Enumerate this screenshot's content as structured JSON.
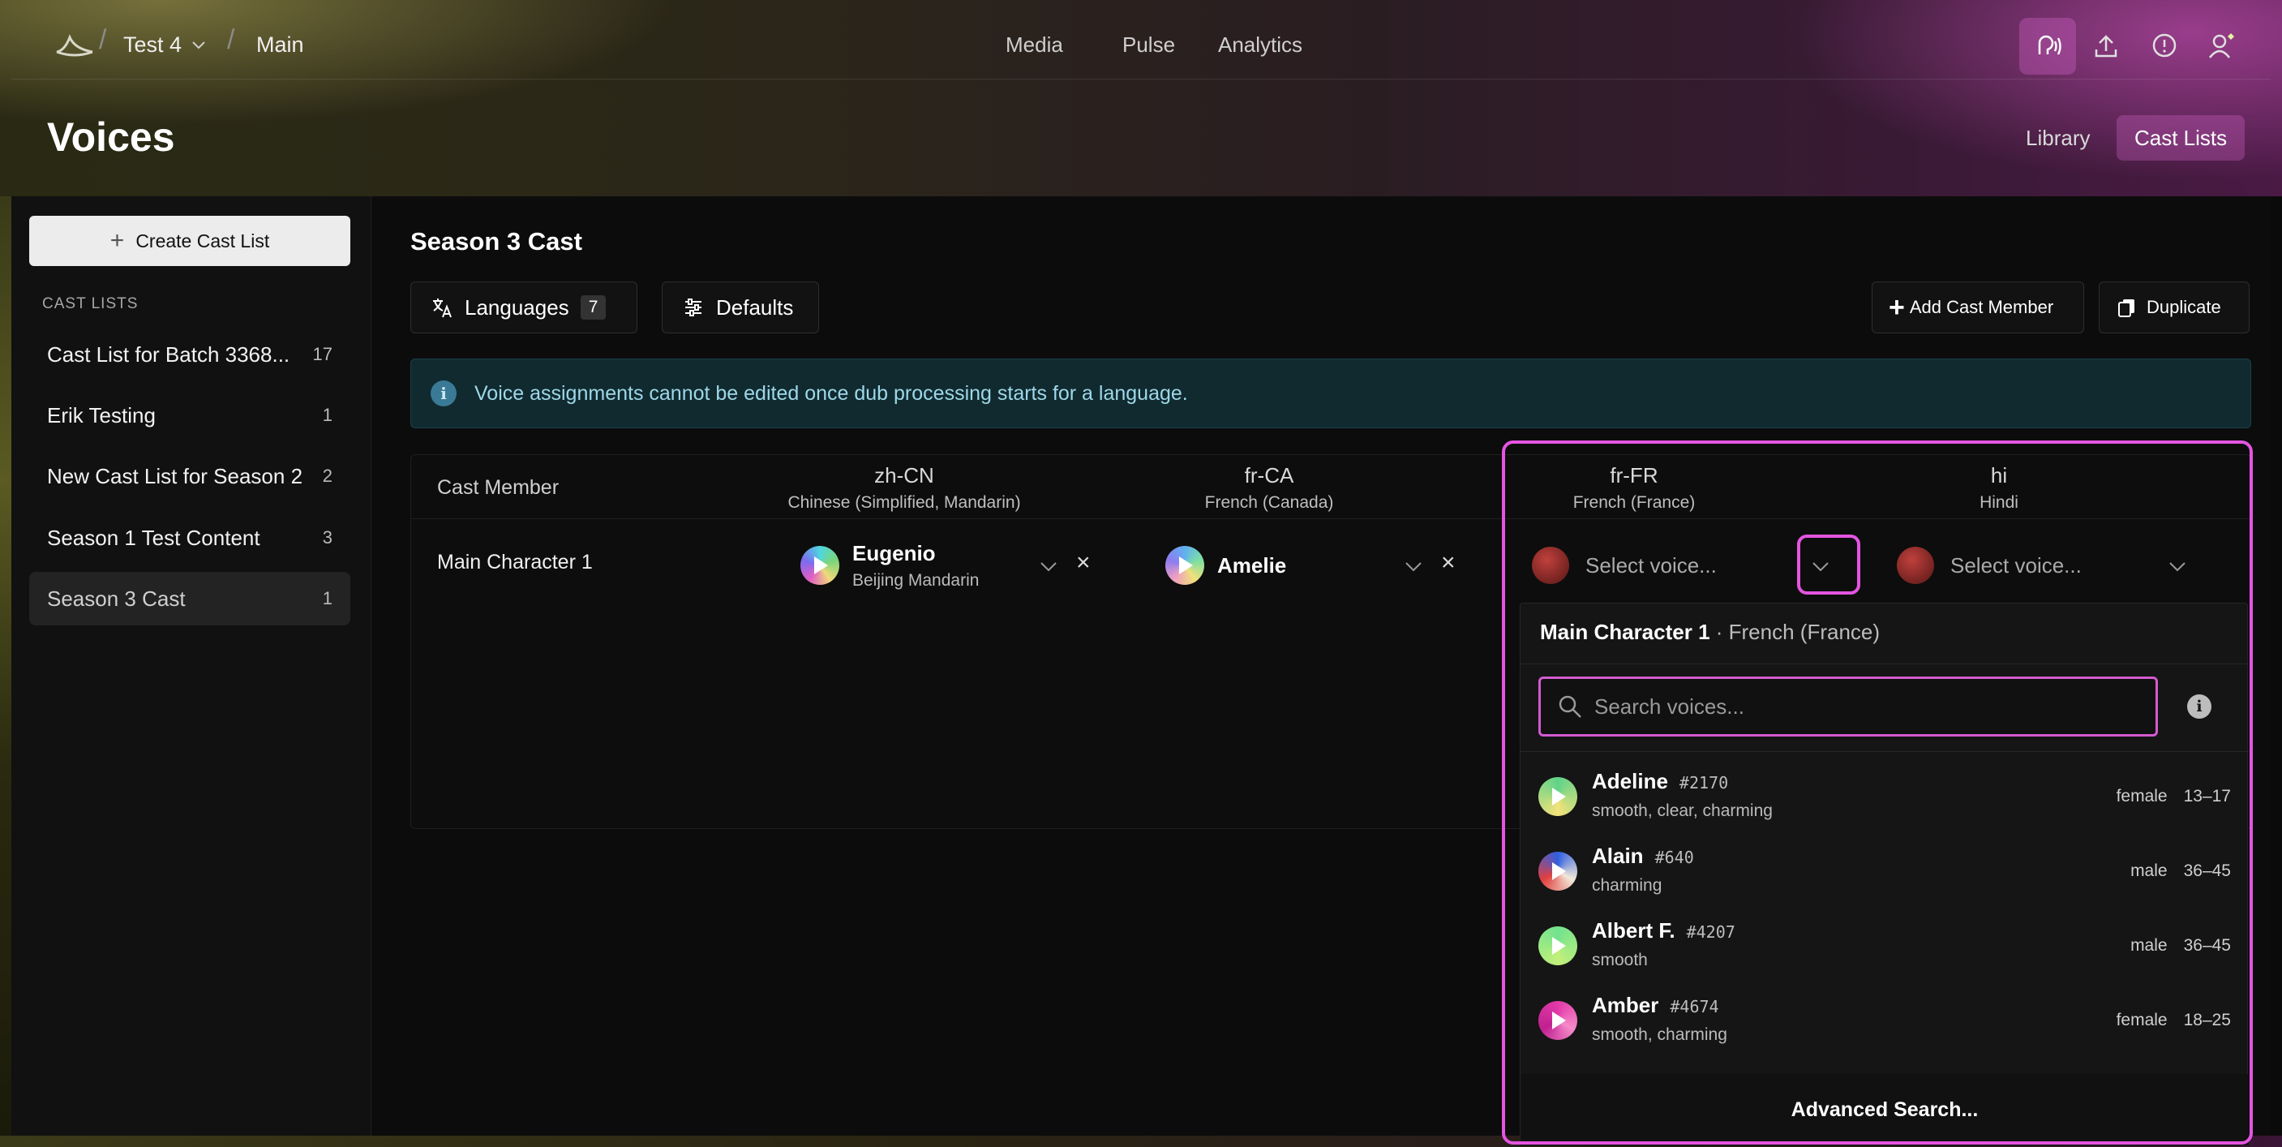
{
  "topbar": {
    "breadcrumb": [
      "Test 4",
      "Main"
    ],
    "nav": [
      "Media",
      "Pulse",
      "Analytics"
    ]
  },
  "header": {
    "title": "Voices",
    "tabs": [
      {
        "label": "Library",
        "active": false
      },
      {
        "label": "Cast Lists",
        "active": true
      }
    ]
  },
  "sidebar": {
    "create_label": "Create Cast List",
    "section_label": "CAST LISTS",
    "items": [
      {
        "name": "Cast List for Batch 3368...",
        "count": "17"
      },
      {
        "name": "Erik Testing",
        "count": "1"
      },
      {
        "name": "New Cast List for Season 2",
        "count": "2"
      },
      {
        "name": "Season 1 Test Content",
        "count": "3"
      },
      {
        "name": "Season 3 Cast",
        "count": "1",
        "active": true
      }
    ]
  },
  "main": {
    "title": "Season 3 Cast",
    "languages_label": "Languages",
    "languages_count": "7",
    "defaults_label": "Defaults",
    "add_member_label": "Add Cast Member",
    "duplicate_label": "Duplicate",
    "info_text": "Voice assignments cannot be edited once dub processing starts for a language."
  },
  "grid": {
    "cast_member_header": "Cast Member",
    "columns": [
      {
        "code": "zh-CN",
        "lang": "Chinese (Simplified, Mandarin)"
      },
      {
        "code": "fr-CA",
        "lang": "French (Canada)"
      },
      {
        "code": "fr-FR",
        "lang": "French (France)"
      },
      {
        "code": "hi",
        "lang": "Hindi"
      }
    ],
    "row": {
      "name": "Main Character 1",
      "zh_voice": {
        "name": "Eugenio",
        "sub": "Beijing Mandarin"
      },
      "frca_voice": {
        "name": "Amelie"
      },
      "frfr_placeholder": "Select voice...",
      "hi_placeholder": "Select voice..."
    }
  },
  "dropdown": {
    "title_bold": "Main Character 1",
    "title_lang": " · French (France)",
    "search_placeholder": "Search voices...",
    "voices": [
      {
        "name": "Adeline",
        "id": "#2170",
        "desc": "smooth, clear, charming",
        "gender": "female",
        "age": "13–17",
        "colors": "#5fd38a,#f4e27a"
      },
      {
        "name": "Alain",
        "id": "#640",
        "desc": "charming",
        "gender": "male",
        "age": "36–45",
        "colors": "#2f5fe0,#f2e8d8"
      },
      {
        "name": "Albert F.",
        "id": "#4207",
        "desc": "smooth",
        "gender": "male",
        "age": "36–45",
        "colors": "#72e28f,#c2f07a"
      },
      {
        "name": "Amber",
        "id": "#4674",
        "desc": "smooth, charming",
        "gender": "female",
        "age": "18–25",
        "colors": "#e23aa8,#f58ac9"
      }
    ],
    "footer": "Advanced Search..."
  },
  "colors": {
    "accent": "#e455e0",
    "info_bg": "#102a30",
    "info_text": "#9ed8e8"
  }
}
